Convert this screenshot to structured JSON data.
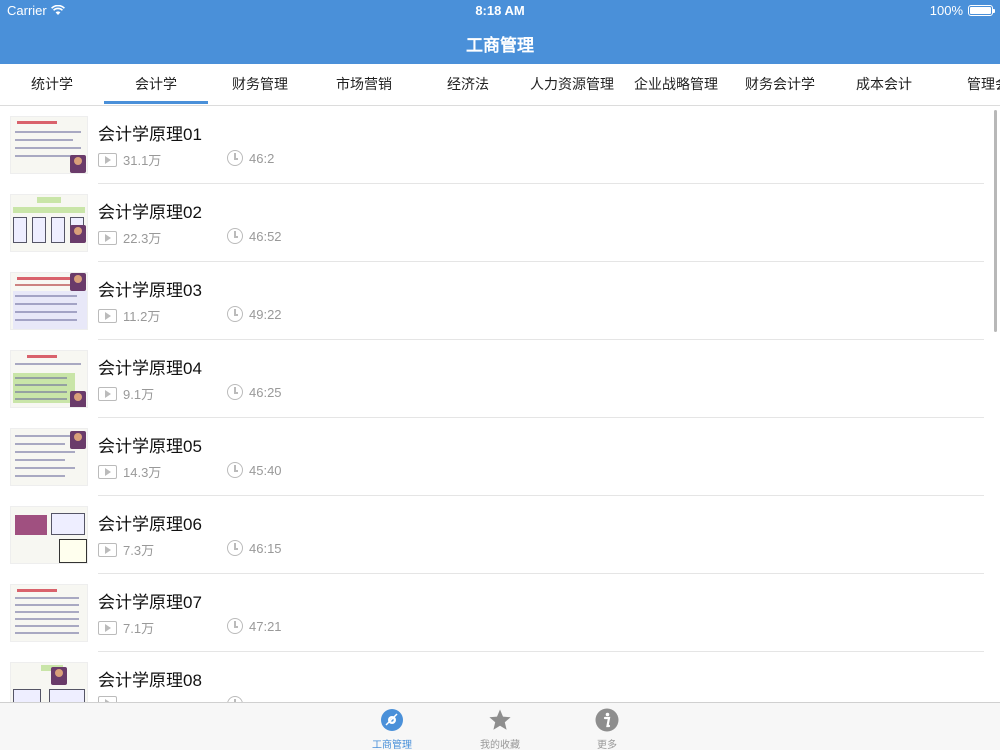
{
  "status_bar": {
    "carrier": "Carrier",
    "time": "8:18 AM",
    "battery": "100%"
  },
  "nav": {
    "title": "工商管理"
  },
  "categories": {
    "active_index": 1,
    "items": [
      "统计学",
      "会计学",
      "财务管理",
      "市场营销",
      "经济法",
      "人力资源管理",
      "企业战略管理",
      "财务会计学",
      "成本会计",
      "管理会"
    ]
  },
  "videos": [
    {
      "title": "会计学原理01",
      "views": "31.1万",
      "duration": "46:2"
    },
    {
      "title": "会计学原理02",
      "views": "22.3万",
      "duration": "46:52"
    },
    {
      "title": "会计学原理03",
      "views": "11.2万",
      "duration": "49:22"
    },
    {
      "title": "会计学原理04",
      "views": "9.1万",
      "duration": "46:25"
    },
    {
      "title": "会计学原理05",
      "views": "14.3万",
      "duration": "45:40"
    },
    {
      "title": "会计学原理06",
      "views": "7.3万",
      "duration": "46:15"
    },
    {
      "title": "会计学原理07",
      "views": "7.1万",
      "duration": "47:21"
    },
    {
      "title": "会计学原理08",
      "views": "",
      "duration": ""
    }
  ],
  "tab_bar": {
    "active_index": 0,
    "items": [
      {
        "label": "工商管理",
        "icon": "disc-icon"
      },
      {
        "label": "我的收藏",
        "icon": "star-icon"
      },
      {
        "label": "更多",
        "icon": "info-icon"
      }
    ]
  },
  "colors": {
    "accent": "#4a90d9"
  }
}
